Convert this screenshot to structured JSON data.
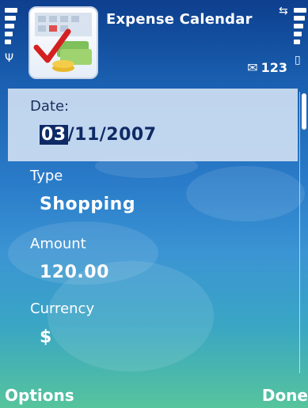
{
  "app": {
    "title": "Expense Calendar"
  },
  "status": {
    "messages": "123"
  },
  "form": {
    "date": {
      "label": "Date:",
      "value_selected": "03",
      "value_rest": "/11/2007"
    },
    "type": {
      "label": "Type",
      "value": "Shopping"
    },
    "amount": {
      "label": "Amount",
      "value": "120.00"
    },
    "currency": {
      "label": "Currency",
      "value": "$"
    }
  },
  "softkeys": {
    "left": "Options",
    "right": "Done"
  }
}
